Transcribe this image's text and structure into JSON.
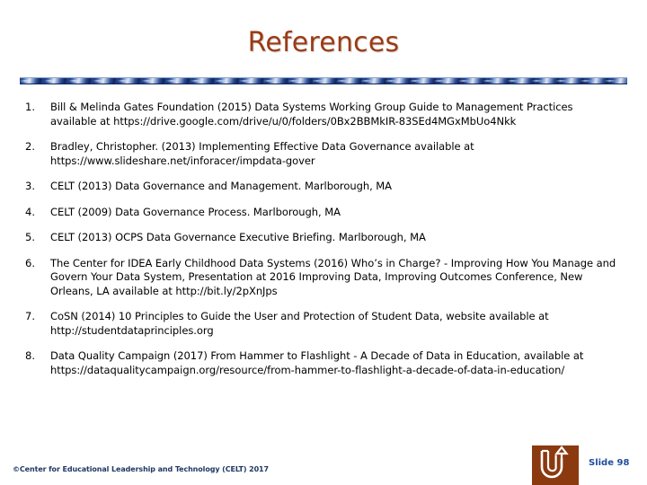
{
  "slide": {
    "title": "References",
    "references": [
      {
        "number": "1.",
        "text": "Bill & Melinda Gates Foundation (2015) Data Systems Working Group Guide to Management Practices available at https://drive.google.com/drive/u/0/folders/0Bx2BBMkIR-83SEd4MGxMbUo4Nkk"
      },
      {
        "number": "2.",
        "text": "Bradley, Christopher. (2013) Implementing Effective Data Governance available at https://www.slideshare.net/inforacer/impdata-gover"
      },
      {
        "number": "3.",
        "text": "CELT (2013) Data Governance and Management. Marlborough, MA"
      },
      {
        "number": "4.",
        "text": "CELT (2009) Data Governance Process. Marlborough, MA"
      },
      {
        "number": "5.",
        "text": "CELT (2013) OCPS Data Governance Executive Briefing. Marlborough, MA"
      },
      {
        "number": "6.",
        "text": "The Center for IDEA Early Childhood Data Systems (2016) Who’s in Charge? - Improving How You Manage and Govern Your Data System, Presentation at 2016 Improving Data, Improving Outcomes Conference, New Orleans, LA available at http://bit.ly/2pXnJps"
      },
      {
        "number": "7.",
        "text": "CoSN (2014) 10 Principles to Guide the User and Protection of Student Data, website available at http://studentdataprinciples.org"
      },
      {
        "number": "8.",
        "text": "Data Quality Campaign (2017) From Hammer to Flashlight - A Decade of Data in Education, available at https://dataqualitycampaign.org/resource/from-hammer-to-flashlight-a-decade-of-data-in-education/"
      }
    ],
    "footer": {
      "copyright": "©Center for Educational Leadership and Technology (CELT) 2017",
      "slide_number": "Slide 98",
      "logo_icon": "u-turn-arrow-icon"
    },
    "colors": {
      "title": "#9C3A13",
      "divider": "#2b4f8e",
      "logo_background": "#8B3A10",
      "slide_number": "#1F4E9C",
      "copyright": "#1F3864",
      "body_text": "#000000"
    }
  }
}
